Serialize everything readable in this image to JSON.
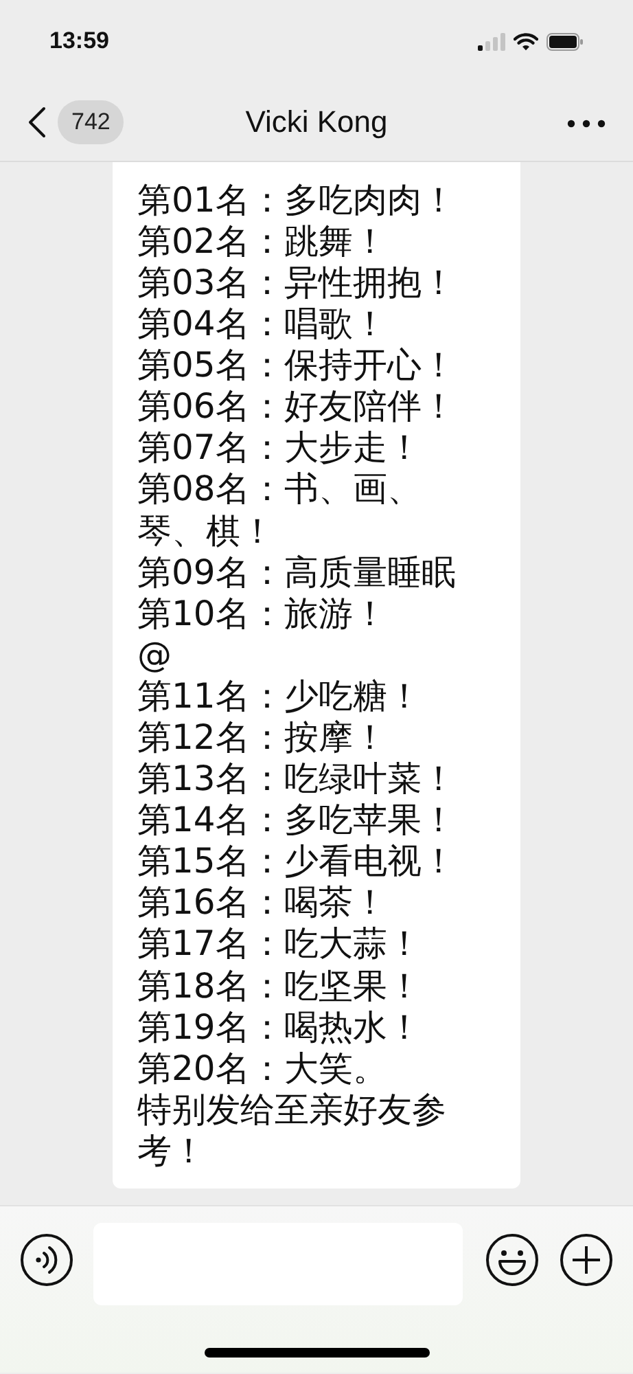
{
  "status_bar": {
    "time": "13:59"
  },
  "nav": {
    "unread": "742",
    "title": "Vicki Kong"
  },
  "message": {
    "lines": [
      "第01名：多吃肉肉！",
      "第02名：跳舞！",
      "第03名：异性拥抱！",
      "第04名：唱歌！",
      "第05名：保持开心！",
      "第06名：好友陪伴！",
      "第07名：大步走！",
      "第08名：书、画、琴、棋！",
      "第09名：高质量睡眠",
      "第10名：旅游！",
      "@",
      "第11名：少吃糖！",
      "第12名：按摩！",
      "第13名：吃绿叶菜！",
      "第14名：多吃苹果！",
      "第15名：少看电视！",
      "第16名：喝茶！",
      "第17名：吃大蒜！",
      "第18名：吃坚果！",
      "第19名：喝热水！",
      "第20名：大笑。",
      "特别发给至亲好友参考！"
    ]
  }
}
